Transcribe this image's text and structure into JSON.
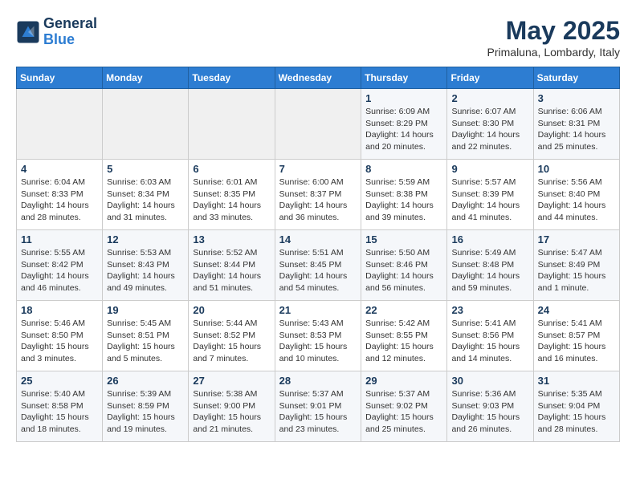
{
  "header": {
    "logo_line1": "General",
    "logo_line2": "Blue",
    "month_title": "May 2025",
    "subtitle": "Primaluna, Lombardy, Italy"
  },
  "weekdays": [
    "Sunday",
    "Monday",
    "Tuesday",
    "Wednesday",
    "Thursday",
    "Friday",
    "Saturday"
  ],
  "weeks": [
    [
      {
        "day": "",
        "info": ""
      },
      {
        "day": "",
        "info": ""
      },
      {
        "day": "",
        "info": ""
      },
      {
        "day": "",
        "info": ""
      },
      {
        "day": "1",
        "info": "Sunrise: 6:09 AM\nSunset: 8:29 PM\nDaylight: 14 hours\nand 20 minutes."
      },
      {
        "day": "2",
        "info": "Sunrise: 6:07 AM\nSunset: 8:30 PM\nDaylight: 14 hours\nand 22 minutes."
      },
      {
        "day": "3",
        "info": "Sunrise: 6:06 AM\nSunset: 8:31 PM\nDaylight: 14 hours\nand 25 minutes."
      }
    ],
    [
      {
        "day": "4",
        "info": "Sunrise: 6:04 AM\nSunset: 8:33 PM\nDaylight: 14 hours\nand 28 minutes."
      },
      {
        "day": "5",
        "info": "Sunrise: 6:03 AM\nSunset: 8:34 PM\nDaylight: 14 hours\nand 31 minutes."
      },
      {
        "day": "6",
        "info": "Sunrise: 6:01 AM\nSunset: 8:35 PM\nDaylight: 14 hours\nand 33 minutes."
      },
      {
        "day": "7",
        "info": "Sunrise: 6:00 AM\nSunset: 8:37 PM\nDaylight: 14 hours\nand 36 minutes."
      },
      {
        "day": "8",
        "info": "Sunrise: 5:59 AM\nSunset: 8:38 PM\nDaylight: 14 hours\nand 39 minutes."
      },
      {
        "day": "9",
        "info": "Sunrise: 5:57 AM\nSunset: 8:39 PM\nDaylight: 14 hours\nand 41 minutes."
      },
      {
        "day": "10",
        "info": "Sunrise: 5:56 AM\nSunset: 8:40 PM\nDaylight: 14 hours\nand 44 minutes."
      }
    ],
    [
      {
        "day": "11",
        "info": "Sunrise: 5:55 AM\nSunset: 8:42 PM\nDaylight: 14 hours\nand 46 minutes."
      },
      {
        "day": "12",
        "info": "Sunrise: 5:53 AM\nSunset: 8:43 PM\nDaylight: 14 hours\nand 49 minutes."
      },
      {
        "day": "13",
        "info": "Sunrise: 5:52 AM\nSunset: 8:44 PM\nDaylight: 14 hours\nand 51 minutes."
      },
      {
        "day": "14",
        "info": "Sunrise: 5:51 AM\nSunset: 8:45 PM\nDaylight: 14 hours\nand 54 minutes."
      },
      {
        "day": "15",
        "info": "Sunrise: 5:50 AM\nSunset: 8:46 PM\nDaylight: 14 hours\nand 56 minutes."
      },
      {
        "day": "16",
        "info": "Sunrise: 5:49 AM\nSunset: 8:48 PM\nDaylight: 14 hours\nand 59 minutes."
      },
      {
        "day": "17",
        "info": "Sunrise: 5:47 AM\nSunset: 8:49 PM\nDaylight: 15 hours\nand 1 minute."
      }
    ],
    [
      {
        "day": "18",
        "info": "Sunrise: 5:46 AM\nSunset: 8:50 PM\nDaylight: 15 hours\nand 3 minutes."
      },
      {
        "day": "19",
        "info": "Sunrise: 5:45 AM\nSunset: 8:51 PM\nDaylight: 15 hours\nand 5 minutes."
      },
      {
        "day": "20",
        "info": "Sunrise: 5:44 AM\nSunset: 8:52 PM\nDaylight: 15 hours\nand 7 minutes."
      },
      {
        "day": "21",
        "info": "Sunrise: 5:43 AM\nSunset: 8:53 PM\nDaylight: 15 hours\nand 10 minutes."
      },
      {
        "day": "22",
        "info": "Sunrise: 5:42 AM\nSunset: 8:55 PM\nDaylight: 15 hours\nand 12 minutes."
      },
      {
        "day": "23",
        "info": "Sunrise: 5:41 AM\nSunset: 8:56 PM\nDaylight: 15 hours\nand 14 minutes."
      },
      {
        "day": "24",
        "info": "Sunrise: 5:41 AM\nSunset: 8:57 PM\nDaylight: 15 hours\nand 16 minutes."
      }
    ],
    [
      {
        "day": "25",
        "info": "Sunrise: 5:40 AM\nSunset: 8:58 PM\nDaylight: 15 hours\nand 18 minutes."
      },
      {
        "day": "26",
        "info": "Sunrise: 5:39 AM\nSunset: 8:59 PM\nDaylight: 15 hours\nand 19 minutes."
      },
      {
        "day": "27",
        "info": "Sunrise: 5:38 AM\nSunset: 9:00 PM\nDaylight: 15 hours\nand 21 minutes."
      },
      {
        "day": "28",
        "info": "Sunrise: 5:37 AM\nSunset: 9:01 PM\nDaylight: 15 hours\nand 23 minutes."
      },
      {
        "day": "29",
        "info": "Sunrise: 5:37 AM\nSunset: 9:02 PM\nDaylight: 15 hours\nand 25 minutes."
      },
      {
        "day": "30",
        "info": "Sunrise: 5:36 AM\nSunset: 9:03 PM\nDaylight: 15 hours\nand 26 minutes."
      },
      {
        "day": "31",
        "info": "Sunrise: 5:35 AM\nSunset: 9:04 PM\nDaylight: 15 hours\nand 28 minutes."
      }
    ]
  ]
}
